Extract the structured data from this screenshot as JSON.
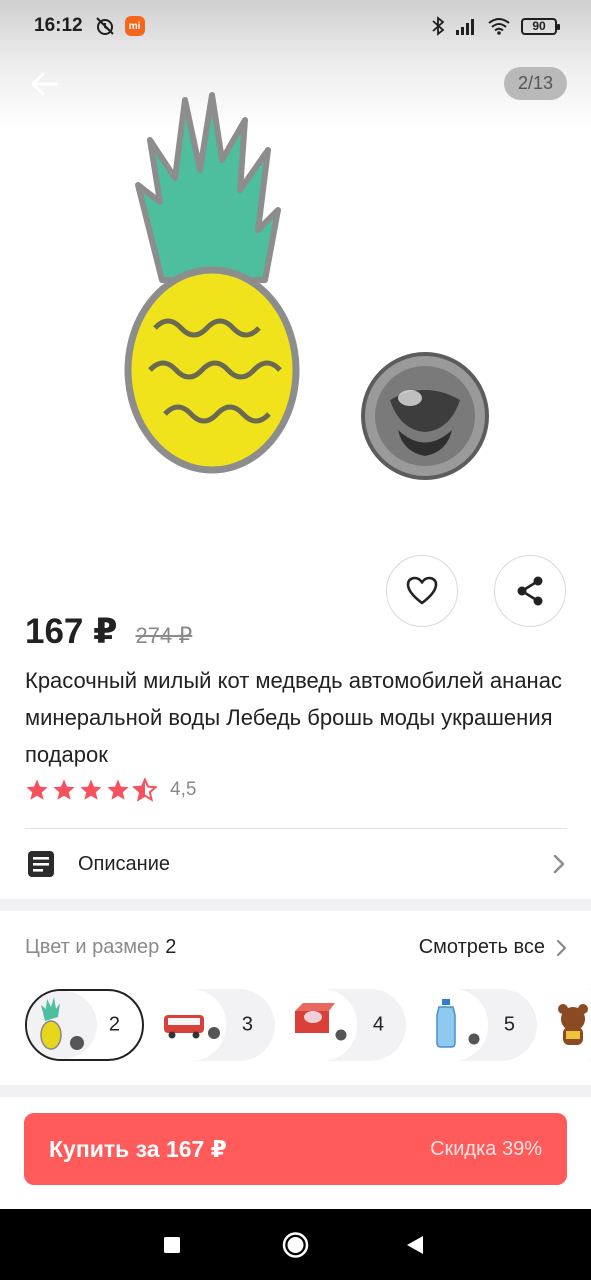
{
  "status_bar": {
    "time": "16:12",
    "battery": "90",
    "mi_badge": "mi",
    "icons": [
      "muted-alarm-icon",
      "mi-app-icon",
      "bluetooth-icon",
      "signal-icon",
      "wifi-icon",
      "battery-icon"
    ]
  },
  "gallery": {
    "counter": "2/13",
    "image": "pineapple-pin-photo"
  },
  "product": {
    "price": "167 ₽",
    "old_price": "274 ₽",
    "title": "Красочный милый кот медведь автомобилей ананас минеральной воды Лебедь брошь моды украшения подарок",
    "rating_value": "4,5",
    "rating_stars": 4.5,
    "star_color": "#f5525e"
  },
  "description": {
    "label": "Описание"
  },
  "variants": {
    "caption": "Цвет и размер",
    "count": "2",
    "see_all": "Смотреть все",
    "items": [
      {
        "num": "2",
        "thumb": "pineapple-pin",
        "selected": true
      },
      {
        "num": "3",
        "thumb": "bus-pin",
        "selected": false
      },
      {
        "num": "4",
        "thumb": "cat-box-pin",
        "selected": false
      },
      {
        "num": "5",
        "thumb": "water-bottle-pin",
        "selected": false
      },
      {
        "num": "",
        "thumb": "bear-pin",
        "selected": false
      }
    ]
  },
  "buy": {
    "label": "Купить за 167 ₽",
    "discount": "Скидка 39%",
    "color": "#ff5b5b"
  },
  "nav": {
    "icons": [
      "recents-icon",
      "home-icon",
      "back-icon"
    ]
  }
}
